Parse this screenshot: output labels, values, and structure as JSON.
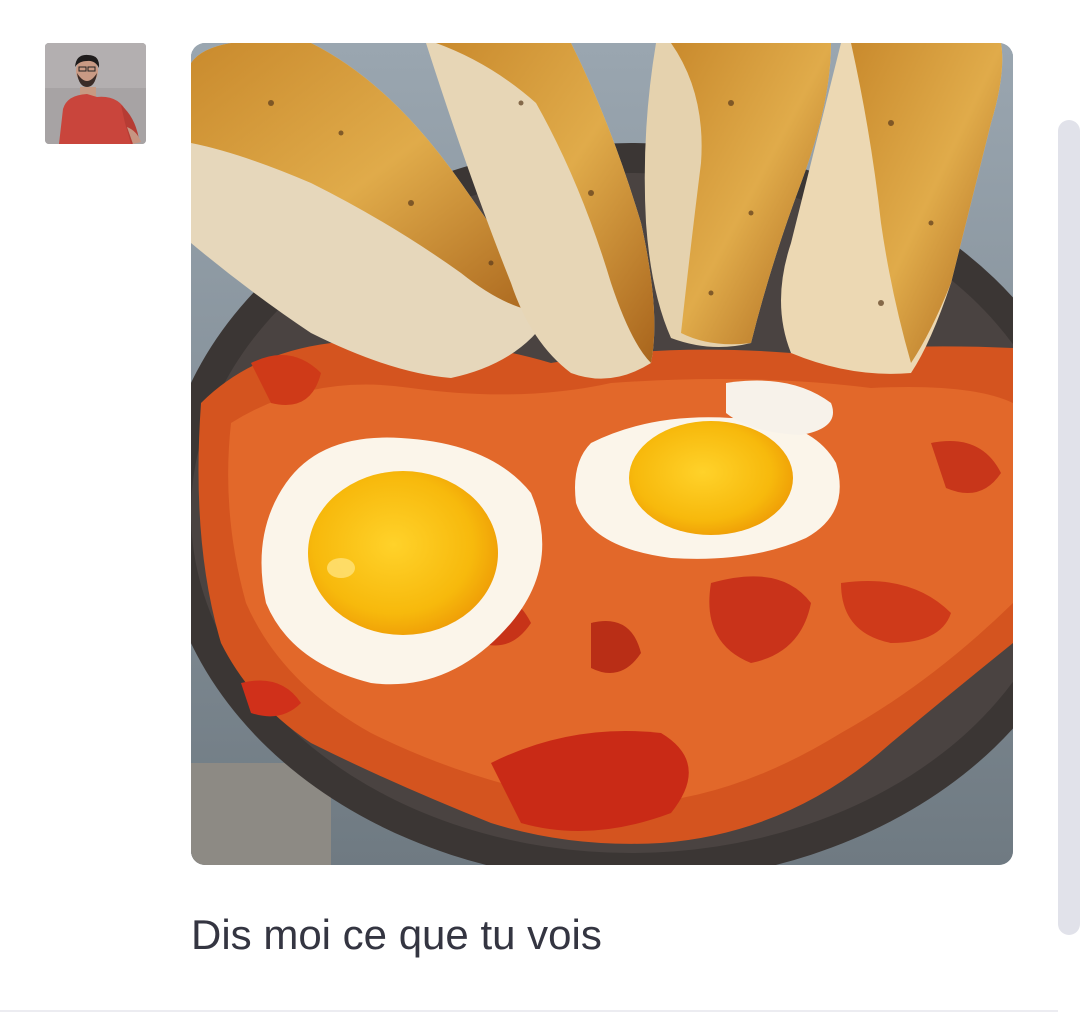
{
  "message": {
    "author": "user",
    "text": "Dis moi ce que tu vois",
    "has_image_attachment": true
  },
  "icons": {
    "avatar": "user-avatar",
    "attachment": "food-photo"
  },
  "colors": {
    "text": "#343541",
    "scrollbar": "#e1e2ea",
    "divider": "#ececf1",
    "background": "#ffffff"
  }
}
